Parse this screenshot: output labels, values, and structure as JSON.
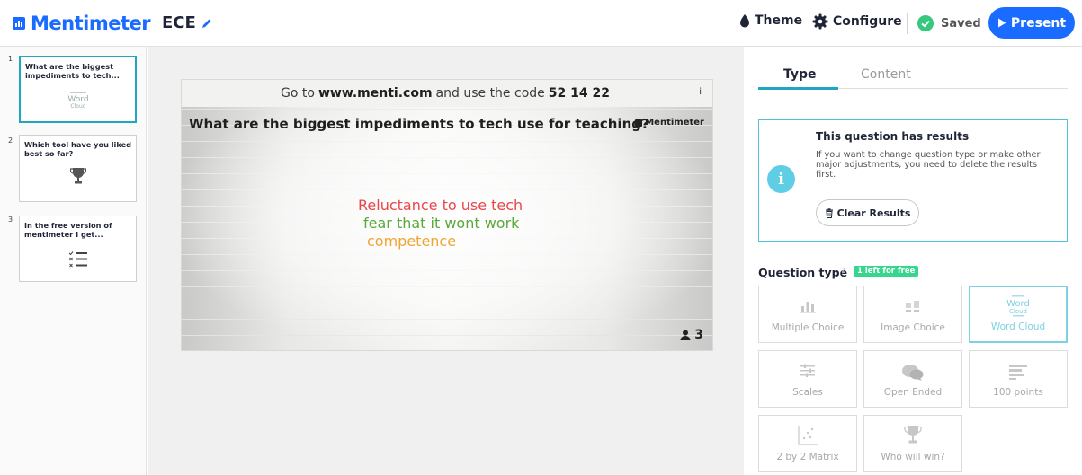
{
  "app": {
    "brand": "Mentimeter",
    "presentation_title": "ECE",
    "accent_color": "#196cff"
  },
  "toolbar": {
    "theme_label": "Theme",
    "configure_label": "Configure",
    "saved_label": "Saved",
    "present_label": "Present"
  },
  "slides": [
    {
      "num": "1",
      "title": "What are the biggest impediments to tech...",
      "icon": "word-cloud-icon",
      "active": true
    },
    {
      "num": "2",
      "title": "Which tool have you liked best so far?",
      "icon": "trophy-icon",
      "active": false
    },
    {
      "num": "3",
      "title": "In the free version of mentimeter I get...",
      "icon": "checklist-icon",
      "active": false
    }
  ],
  "slide_preview": {
    "instruction_prefix": "Go to",
    "url": "www.menti.com",
    "instruction_mid": "and use the code",
    "code": "52 14 22",
    "info_glyph": "i",
    "question": "What are the biggest impediments to tech use for teaching?",
    "brand": "Mentimeter",
    "words": [
      {
        "text": "Reluctance to use tech",
        "color": "#e8474b"
      },
      {
        "text": "fear that it wont work",
        "color": "#5ba83a"
      },
      {
        "text": "competence",
        "color": "#f0a531"
      }
    ],
    "voter_count": "3"
  },
  "panel": {
    "tabs": [
      "Type",
      "Content"
    ],
    "active_tab": "Type",
    "results_title": "This question has results",
    "results_text": "If you want to change question type or make other major adjustments, you need to delete the results first.",
    "clear_label": "Clear Results",
    "question_type_label": "Question type",
    "help_glyph": "?",
    "free_badge": "1 left for free",
    "types": [
      {
        "label": "Multiple Choice",
        "icon": "bar-chart-icon",
        "selected": false
      },
      {
        "label": "Image Choice",
        "icon": "image-choice-icon",
        "selected": false
      },
      {
        "label": "Word Cloud",
        "icon": "word-cloud-icon",
        "selected": true
      },
      {
        "label": "Scales",
        "icon": "scales-icon",
        "selected": false
      },
      {
        "label": "Open Ended",
        "icon": "speech-bubbles-icon",
        "selected": false
      },
      {
        "label": "100 points",
        "icon": "lines-icon",
        "selected": false
      },
      {
        "label": "2 by 2 Matrix",
        "icon": "matrix-icon",
        "selected": false
      },
      {
        "label": "Who will win?",
        "icon": "trophy-icon",
        "selected": false
      }
    ]
  }
}
